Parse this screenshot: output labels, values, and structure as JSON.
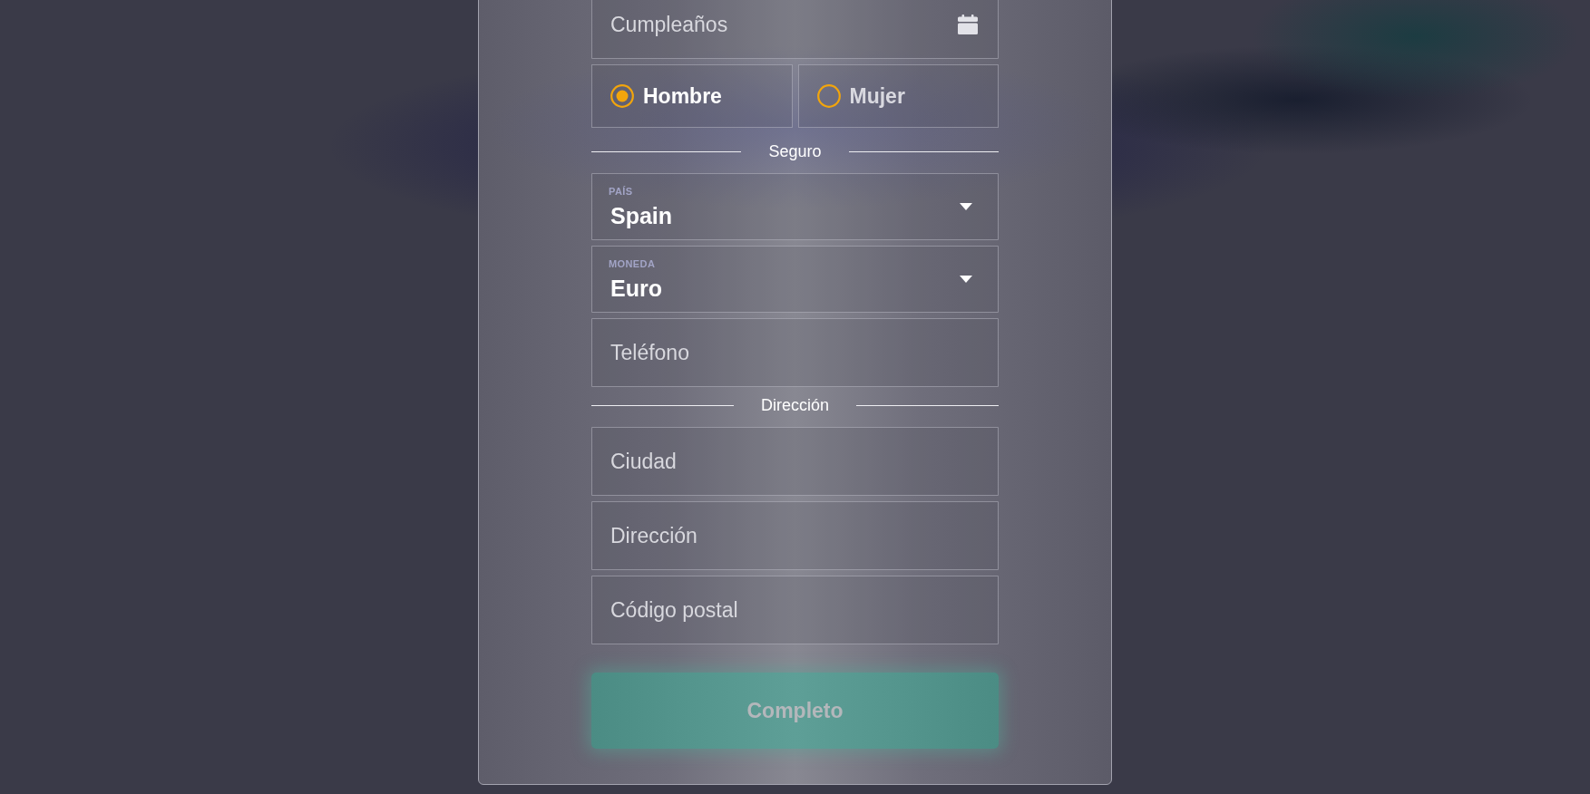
{
  "birthday": {
    "placeholder": "Cumpleaños"
  },
  "gender": [
    {
      "label": "Hombre",
      "selected": true
    },
    {
      "label": "Mujer",
      "selected": false
    }
  ],
  "sections": [
    {
      "title": "Seguro",
      "fields": [
        {
          "kind": "select",
          "label": "PAÍS",
          "value": "Spain"
        },
        {
          "kind": "select",
          "label": "MONEDA",
          "value": "Euro"
        },
        {
          "kind": "text",
          "placeholder": "Teléfono"
        }
      ]
    },
    {
      "title": "Dirección",
      "fields": [
        {
          "kind": "text",
          "placeholder": "Ciudad"
        },
        {
          "kind": "text",
          "placeholder": "Dirección"
        },
        {
          "kind": "text",
          "placeholder": "Código postal"
        }
      ]
    }
  ],
  "submit": {
    "label": "Completo",
    "disabled": true
  }
}
